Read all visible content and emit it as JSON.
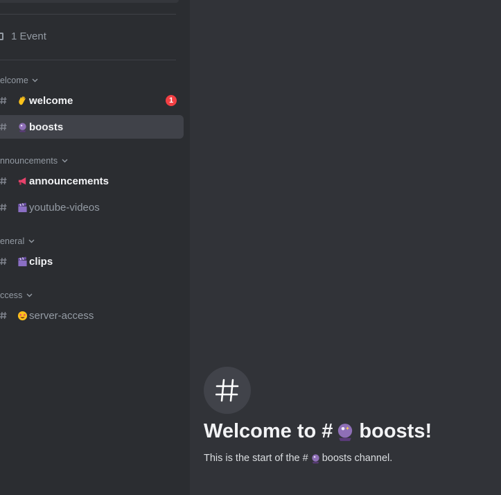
{
  "sidebar": {
    "events_label": "1 Event",
    "categories": [
      {
        "label": "elcome"
      },
      {
        "label": "nnouncements"
      },
      {
        "label": "eneral"
      },
      {
        "label": "ccess"
      }
    ],
    "channels": [
      {
        "name": "welcome",
        "emoji": "waving-hand-icon",
        "unread": true,
        "badge": "1"
      },
      {
        "name": "boosts",
        "emoji": "crystal-ball-icon",
        "selected": true
      },
      {
        "name": "announcements",
        "emoji": "megaphone-icon",
        "unread": true
      },
      {
        "name": "youtube-videos",
        "emoji": "clapper-board-icon"
      },
      {
        "name": "clips",
        "emoji": "clapper-board-icon",
        "unread": true
      },
      {
        "name": "server-access",
        "emoji": "star-struck-face-icon"
      }
    ]
  },
  "main": {
    "welcome_prefix": "Welcome to #",
    "welcome_channel": "boosts!",
    "sub_prefix": "This is the start of the #",
    "sub_channel": "boosts channel."
  },
  "colors": {
    "sidebar_bg": "#2b2d31",
    "main_bg": "#313338",
    "selected_bg": "#404249",
    "badge": "#f23f43"
  }
}
